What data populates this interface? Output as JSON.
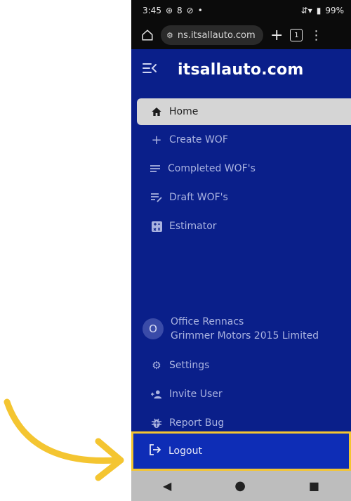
{
  "status": {
    "time": "3:45",
    "battery": "99%"
  },
  "browser": {
    "url": "ns.itsallauto.com",
    "tab_count": "1"
  },
  "app": {
    "brand": "itsallauto.com"
  },
  "nav": [
    {
      "label": "Home",
      "icon": "home-icon"
    },
    {
      "label": "Create WOF",
      "icon": "plus-icon"
    },
    {
      "label": "Completed WOF's",
      "icon": "list-icon"
    },
    {
      "label": "Draft WOF's",
      "icon": "edit-list-icon"
    },
    {
      "label": "Estimator",
      "icon": "calculator-icon"
    }
  ],
  "user": {
    "initial": "O",
    "name": "Office Rennacs",
    "company": "Grimmer Motors 2015 Limited"
  },
  "bottom_nav": [
    {
      "label": "Settings",
      "icon": "gear-icon"
    },
    {
      "label": "Invite User",
      "icon": "add-user-icon"
    },
    {
      "label": "Report Bug",
      "icon": "bug-icon"
    }
  ],
  "logout": {
    "label": "Logout"
  },
  "colors": {
    "sidebar": "#0a1f8a",
    "highlight": "#f4c531",
    "active_bg": "#d5d5d5"
  }
}
